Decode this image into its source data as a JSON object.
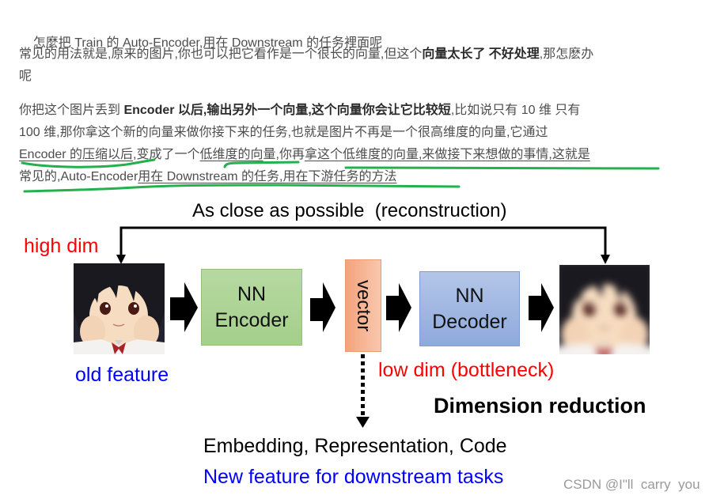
{
  "article": {
    "paragraphs": [
      {
        "lines": [
          [
            "怎麼把 Train 的 Auto-Encoder,用在 Downstream 的任务裡面呢"
          ]
        ]
      },
      {
        "lines": [
          [
            "常见的用法就是,原来的图片,你也可以把它看作是一个很长的向量,但这个",
            "向量太长了 不好处理",
            ",那怎麽办"
          ],
          [
            "呢"
          ]
        ]
      },
      {
        "lines": [
          [
            "你把这个图片丢到 ",
            "Encoder 以后,输出另外一个向量,这个向量你会让它比较短",
            ",比如说只有 10 维 只有"
          ],
          [
            "100 维,那你拿这个新的向量来做你接下来的任务,也就是图片不再是一个很高维度的向量,它通过"
          ],
          [
            "Encoder 的压缩以后",
            ",变成了一个",
            "低维度的向",
            "量,你再",
            "拿这个低维度的向量,来做接下来想做的事情,这就是"
          ],
          [
            "常见的,Auto-Encoder",
            "用在 Downstream 的任务,用在下游任务的方法"
          ]
        ]
      }
    ]
  },
  "diagram": {
    "reconstruction_label": "As close as possible  (reconstruction)",
    "input_label": "high dim",
    "input_caption": "old feature",
    "input_image": "anime-girl-portrait",
    "encoder": {
      "line1": "NN",
      "line2": "Encoder"
    },
    "vector_label": "vector",
    "decoder": {
      "line1": "NN",
      "line2": "Decoder"
    },
    "output_image": "blurred-reconstructed-portrait",
    "bottleneck_label": "low dim (bottleneck)",
    "dimension_reduction_label": "Dimension reduction",
    "embedding_label": "Embedding, Representation, Code",
    "new_feature_label": "New feature for downstream tasks"
  },
  "watermark": "CSDN @I\"ll  carry  you",
  "colors": {
    "text": "#4d4d4d",
    "highlight": "#22b14c",
    "red": "#ff0000",
    "blue": "#0000ff",
    "enc-top": "#b6d9a2",
    "vec-left": "#f4a27c",
    "dec-bot": "#8ea9dc"
  }
}
